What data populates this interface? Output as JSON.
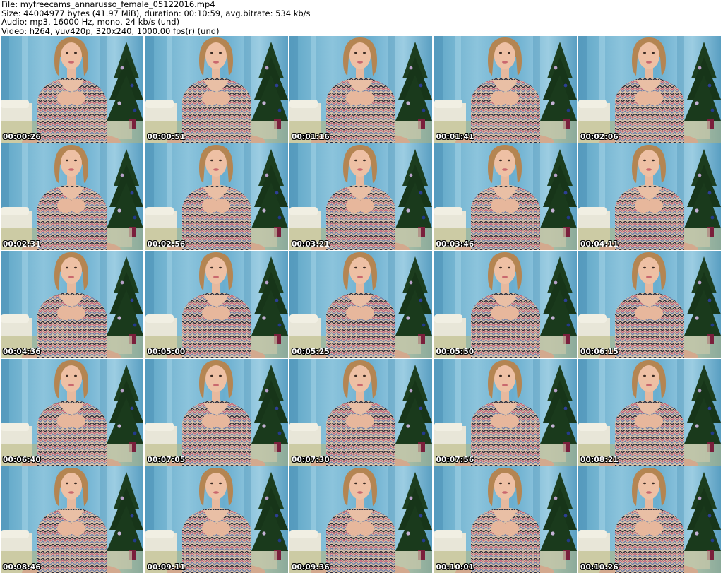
{
  "header": {
    "file": "File: myfreecams_annarusso_female_05122016.mp4",
    "size": "Size: 44004977 bytes (41.97 MiB), duration: 00:10:59, avg.bitrate: 534 kb/s",
    "audio": "Audio: mp3, 16000 Hz, mono, 24 kb/s (und)",
    "video": "Video: h264, yuv420p, 320x240, 1000.00 fps(r) (und)"
  },
  "thumbnails": [
    {
      "time": "00:00:26"
    },
    {
      "time": "00:00:51"
    },
    {
      "time": "00:01:16"
    },
    {
      "time": "00:01:41"
    },
    {
      "time": "00:02:06"
    },
    {
      "time": "00:02:31"
    },
    {
      "time": "00:02:56"
    },
    {
      "time": "00:03:21"
    },
    {
      "time": "00:03:46"
    },
    {
      "time": "00:04:11"
    },
    {
      "time": "00:04:36"
    },
    {
      "time": "00:05:00"
    },
    {
      "time": "00:05:25"
    },
    {
      "time": "00:05:50"
    },
    {
      "time": "00:06:15"
    },
    {
      "time": "00:06:40"
    },
    {
      "time": "00:07:05"
    },
    {
      "time": "00:07:30"
    },
    {
      "time": "00:07:56"
    },
    {
      "time": "00:08:21"
    },
    {
      "time": "00:08:46"
    },
    {
      "time": "00:09:11"
    },
    {
      "time": "00:09:36"
    },
    {
      "time": "00:10:01"
    },
    {
      "time": "00:10:26"
    }
  ]
}
